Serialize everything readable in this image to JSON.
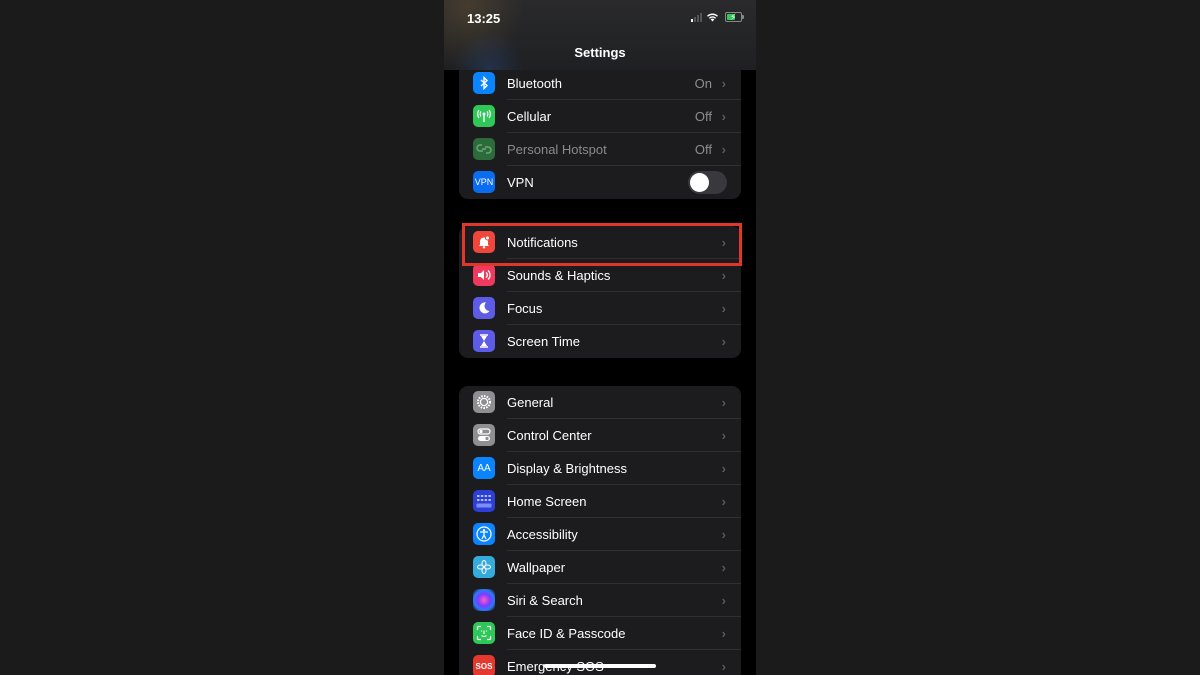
{
  "status_bar": {
    "time": "13:25",
    "signal_icon": "cellular-signal-icon",
    "wifi_icon": "wifi-icon",
    "battery_icon": "battery-charging-icon"
  },
  "nav": {
    "title": "Settings"
  },
  "groups": [
    {
      "rows": [
        {
          "label": "Bluetooth",
          "value": "On",
          "icon": "bluetooth-icon",
          "color": "#0a84ff"
        },
        {
          "label": "Cellular",
          "value": "Off",
          "icon": "antenna-icon",
          "color": "#30c759"
        },
        {
          "label": "Personal Hotspot",
          "value": "Off",
          "icon": "hotspot-icon",
          "color": "#2c6b3a",
          "disabled": true
        },
        {
          "label": "VPN",
          "icon": "vpn-icon",
          "color": "#0a6cf0",
          "icon_text": "VPN",
          "toggle": false
        }
      ]
    },
    {
      "rows": [
        {
          "label": "Notifications",
          "icon": "bell-icon",
          "color": "#f0473c",
          "highlighted": true
        },
        {
          "label": "Sounds & Haptics",
          "icon": "speaker-icon",
          "color": "#ef3a5d"
        },
        {
          "label": "Focus",
          "icon": "moon-icon",
          "color": "#5e5ce6"
        },
        {
          "label": "Screen Time",
          "icon": "hourglass-icon",
          "color": "#5e5ce6"
        }
      ]
    },
    {
      "rows": [
        {
          "label": "General",
          "icon": "gear-icon",
          "color": "#8e8e93"
        },
        {
          "label": "Control Center",
          "icon": "toggles-icon",
          "color": "#8e8e93"
        },
        {
          "label": "Display & Brightness",
          "icon": "text-size-icon",
          "color": "#0a84ff",
          "icon_text": "AA"
        },
        {
          "label": "Home Screen",
          "icon": "app-grid-icon",
          "color": "#2c3fd6"
        },
        {
          "label": "Accessibility",
          "icon": "accessibility-icon",
          "color": "#0a84ff"
        },
        {
          "label": "Wallpaper",
          "icon": "flower-icon",
          "color": "#35aadc"
        },
        {
          "label": "Siri & Search",
          "icon": "siri-icon",
          "color": "#1c1c1e"
        },
        {
          "label": "Face ID & Passcode",
          "icon": "face-id-icon",
          "color": "#30c759"
        },
        {
          "label": "Emergency SOS",
          "icon": "sos-icon",
          "color": "#e5392f",
          "icon_text": "SOS"
        }
      ]
    }
  ],
  "highlight_color": "#e0362c"
}
